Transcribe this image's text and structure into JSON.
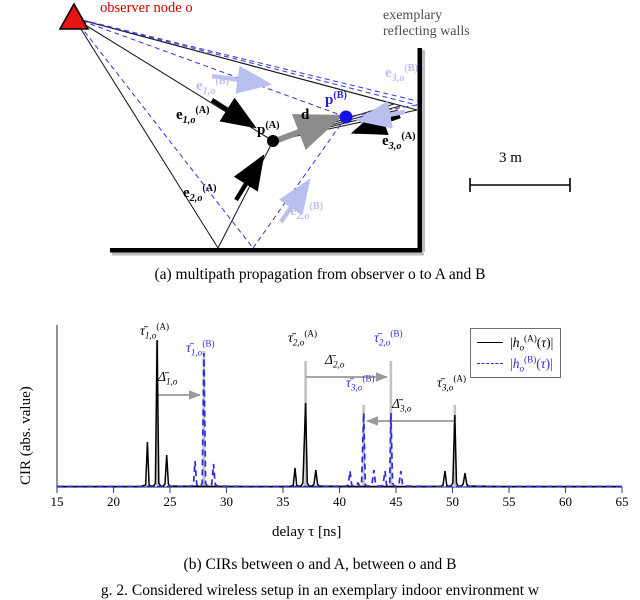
{
  "figure": {
    "subcaption_a": "(a) multipath propagation from observer o to A and B",
    "subcaption_b": "(b) CIRs between o and A, between o and B",
    "main_caption": "g. 2.   Considered wireless setup in an exemplary indoor environment w"
  },
  "diagram": {
    "observer_label": "observer node o",
    "walls_label_line1": "exemplary",
    "walls_label_line2": "reflecting walls",
    "scale_label": "3 m",
    "scale_meters": 3,
    "point_a_label": "p(A)",
    "point_b_label": "p(B)",
    "distance_label": "d",
    "vectors": [
      {
        "name": "e1oA",
        "label": "e1,o(A)",
        "color": "#000000",
        "target": "A"
      },
      {
        "name": "e2oA",
        "label": "e2,o(A)",
        "color": "#000000",
        "target": "A"
      },
      {
        "name": "e3oA",
        "label": "e3,o(A)",
        "color": "#000000",
        "target": "A"
      },
      {
        "name": "e1oB",
        "label": "e1,o(B)",
        "color": "#b9bfee",
        "target": "B"
      },
      {
        "name": "e2oB",
        "label": "e2,o(B)",
        "color": "#b9bfee",
        "target": "B"
      },
      {
        "name": "e3oB",
        "label": "e3,o(B)",
        "color": "#b9bfee",
        "target": "B"
      }
    ],
    "colors": {
      "observer": "#e00000",
      "point_b": "#1414e6",
      "path_a": "#1a1a1a",
      "path_b": "#3a3ae0",
      "wall": "#000000",
      "distance_arrow": "#8c8c8c"
    }
  },
  "chart_data": {
    "type": "line",
    "title": "",
    "xlabel": "delay τ [ns]",
    "ylabel": "CIR (abs. value)",
    "xlim": [
      15,
      65
    ],
    "ylim": [
      0,
      1.05
    ],
    "xticks": [
      15,
      20,
      25,
      30,
      35,
      40,
      45,
      50,
      55,
      60,
      65
    ],
    "yticks": [],
    "grid": false,
    "legend_position": "top-right",
    "series": [
      {
        "name": "|ho(A)(τ)|",
        "color": "#000000",
        "style": "solid",
        "peaks": [
          {
            "tau": 23.0,
            "amp": 0.3
          },
          {
            "tau": 23.85,
            "amp": 1.0
          },
          {
            "tau": 24.35,
            "amp": 0.22
          },
          {
            "tau": 36.45,
            "amp": 0.13
          },
          {
            "tau": 37.05,
            "amp": 0.52
          },
          {
            "tau": 37.75,
            "amp": 0.12
          },
          {
            "tau": 49.6,
            "amp": 0.1
          },
          {
            "tau": 50.2,
            "amp": 0.4
          },
          {
            "tau": 50.9,
            "amp": 0.09
          }
        ]
      },
      {
        "name": "|ho(B)(τ)|",
        "color": "#2a2ae0",
        "style": "dashed",
        "peaks": [
          {
            "tau": 27.45,
            "amp": 0.16
          },
          {
            "tau": 28.0,
            "amp": 0.82
          },
          {
            "tau": 28.6,
            "amp": 0.14
          },
          {
            "tau": 41.7,
            "amp": 0.11
          },
          {
            "tau": 42.2,
            "amp": 0.47
          },
          {
            "tau": 42.8,
            "amp": 0.11
          },
          {
            "tau": 44.1,
            "amp": 0.11
          },
          {
            "tau": 44.6,
            "amp": 0.47
          },
          {
            "tau": 45.2,
            "amp": 0.11
          }
        ]
      }
    ],
    "markers": [
      {
        "name": "tau1oA",
        "label": "τ̄1,o(A)",
        "tau": 23.85,
        "color": "#000000"
      },
      {
        "name": "tau1oB",
        "label": "τ̄1,o(B)",
        "tau": 28.0,
        "color": "#2a2ae0"
      },
      {
        "name": "tau2oA",
        "label": "τ̄2,o(A)",
        "tau": 37.05,
        "color": "#000000"
      },
      {
        "name": "tau2oB",
        "label": "τ̄2,o(B)",
        "tau": 44.6,
        "color": "#2a2ae0"
      },
      {
        "name": "tau3oB",
        "label": "τ̄3,o(B)",
        "tau": 42.2,
        "color": "#2a2ae0"
      },
      {
        "name": "tau3oA",
        "label": "τ̄3,o(A)",
        "tau": 50.2,
        "color": "#000000"
      }
    ],
    "deltas": [
      {
        "name": "delta1o",
        "label": "Δ̄1,o",
        "from": 23.85,
        "to": 28.0,
        "direction": "right"
      },
      {
        "name": "delta2o",
        "label": "Δ̄2,o",
        "from": 37.05,
        "to": 44.6,
        "direction": "right"
      },
      {
        "name": "delta3o",
        "label": "Δ̄3,o",
        "from": 50.2,
        "to": 42.2,
        "direction": "left"
      }
    ]
  }
}
